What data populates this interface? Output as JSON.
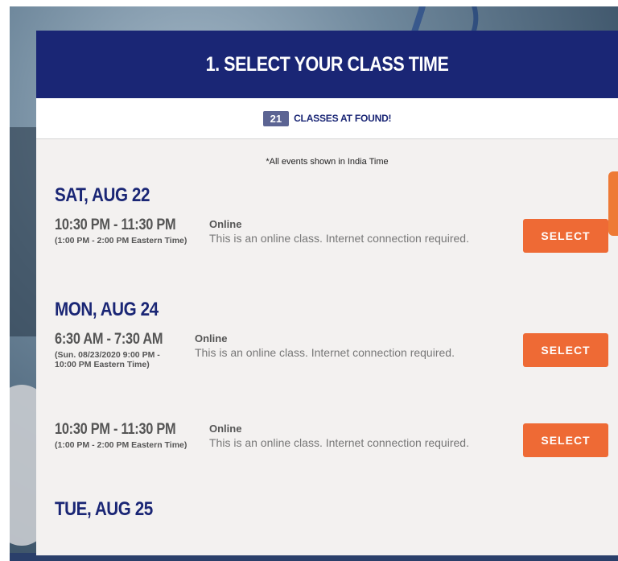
{
  "header": {
    "title": "1. SELECT YOUR CLASS TIME"
  },
  "found": {
    "count": "21",
    "label": "CLASSES AT FOUND!"
  },
  "timezone_note": "*All events shown in India Time",
  "days": [
    {
      "heading": "SAT, AUG 22",
      "classes": [
        {
          "time": "10:30 PM - 11:30 PM",
          "eastern": "(1:00 PM - 2:00 PM Eastern Time)",
          "location": "Online",
          "description": "This is an online class. Internet connection required.",
          "button": "SELECT"
        }
      ]
    },
    {
      "heading": "MON, AUG 24",
      "classes": [
        {
          "time": "6:30 AM - 7:30 AM",
          "eastern": "(Sun. 08/23/2020 9:00 PM - 10:00 PM Eastern Time)",
          "location": "Online",
          "description": "This is an online class. Internet connection required.",
          "button": "SELECT"
        },
        {
          "time": "10:30 PM - 11:30 PM",
          "eastern": "(1:00 PM - 2:00 PM Eastern Time)",
          "location": "Online",
          "description": "This is an online class. Internet connection required.",
          "button": "SELECT"
        }
      ]
    },
    {
      "heading": "TUE, AUG 25",
      "classes": []
    }
  ],
  "colors": {
    "header_bg": "#1a2675",
    "accent": "#ee6a35",
    "badge_bg": "#5c6493",
    "panel_bg": "#f3f1f0"
  }
}
